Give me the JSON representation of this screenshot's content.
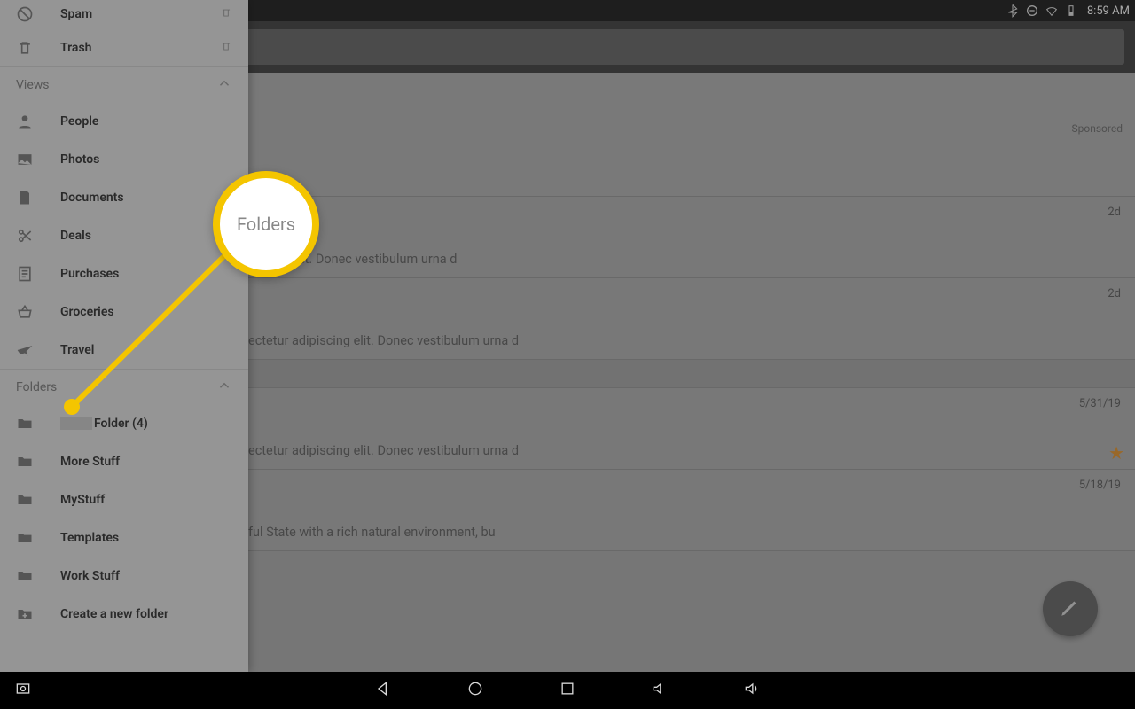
{
  "status": {
    "clock": "8:59 AM"
  },
  "drawer": {
    "top": [
      {
        "label": "Spam",
        "icon": "spam"
      },
      {
        "label": "Trash",
        "icon": "trash"
      }
    ],
    "views_header": "Views",
    "views": [
      {
        "label": "People",
        "icon": "person"
      },
      {
        "label": "Photos",
        "icon": "photo"
      },
      {
        "label": "Documents",
        "icon": "doc"
      },
      {
        "label": "Deals",
        "icon": "scissors"
      },
      {
        "label": "Purchases",
        "icon": "receipt"
      },
      {
        "label": "Groceries",
        "icon": "basket"
      },
      {
        "label": "Travel",
        "icon": "plane"
      }
    ],
    "folders_header": "Folders",
    "folders": [
      {
        "label": "Folder (4)",
        "icon": "folder"
      },
      {
        "label": "More Stuff",
        "icon": "folder"
      },
      {
        "label": "MyStuff",
        "icon": "folder"
      },
      {
        "label": "Templates",
        "icon": "folder"
      },
      {
        "label": "Work Stuff",
        "icon": "folder"
      },
      {
        "label": "Create a new folder",
        "icon": "add-folder"
      }
    ]
  },
  "callout": {
    "label": "Folders"
  },
  "mails": {
    "sponsored_label": "Sponsored",
    "rows": [
      {
        "date": "2d",
        "preview": "lisicing elit. Donec vestibulum urna d",
        "star": false
      },
      {
        "date": "2d",
        "preview": "ectetur adipiscing elit. Donec vestibulum urna d",
        "star": false
      },
      {
        "date": "5/31/19",
        "preview": "ectetur adipiscing elit. Donec vestibulum urna d",
        "star": true
      },
      {
        "date": "5/18/19",
        "preview": "ful State with a rich natural environment, bu",
        "star": false
      }
    ]
  }
}
